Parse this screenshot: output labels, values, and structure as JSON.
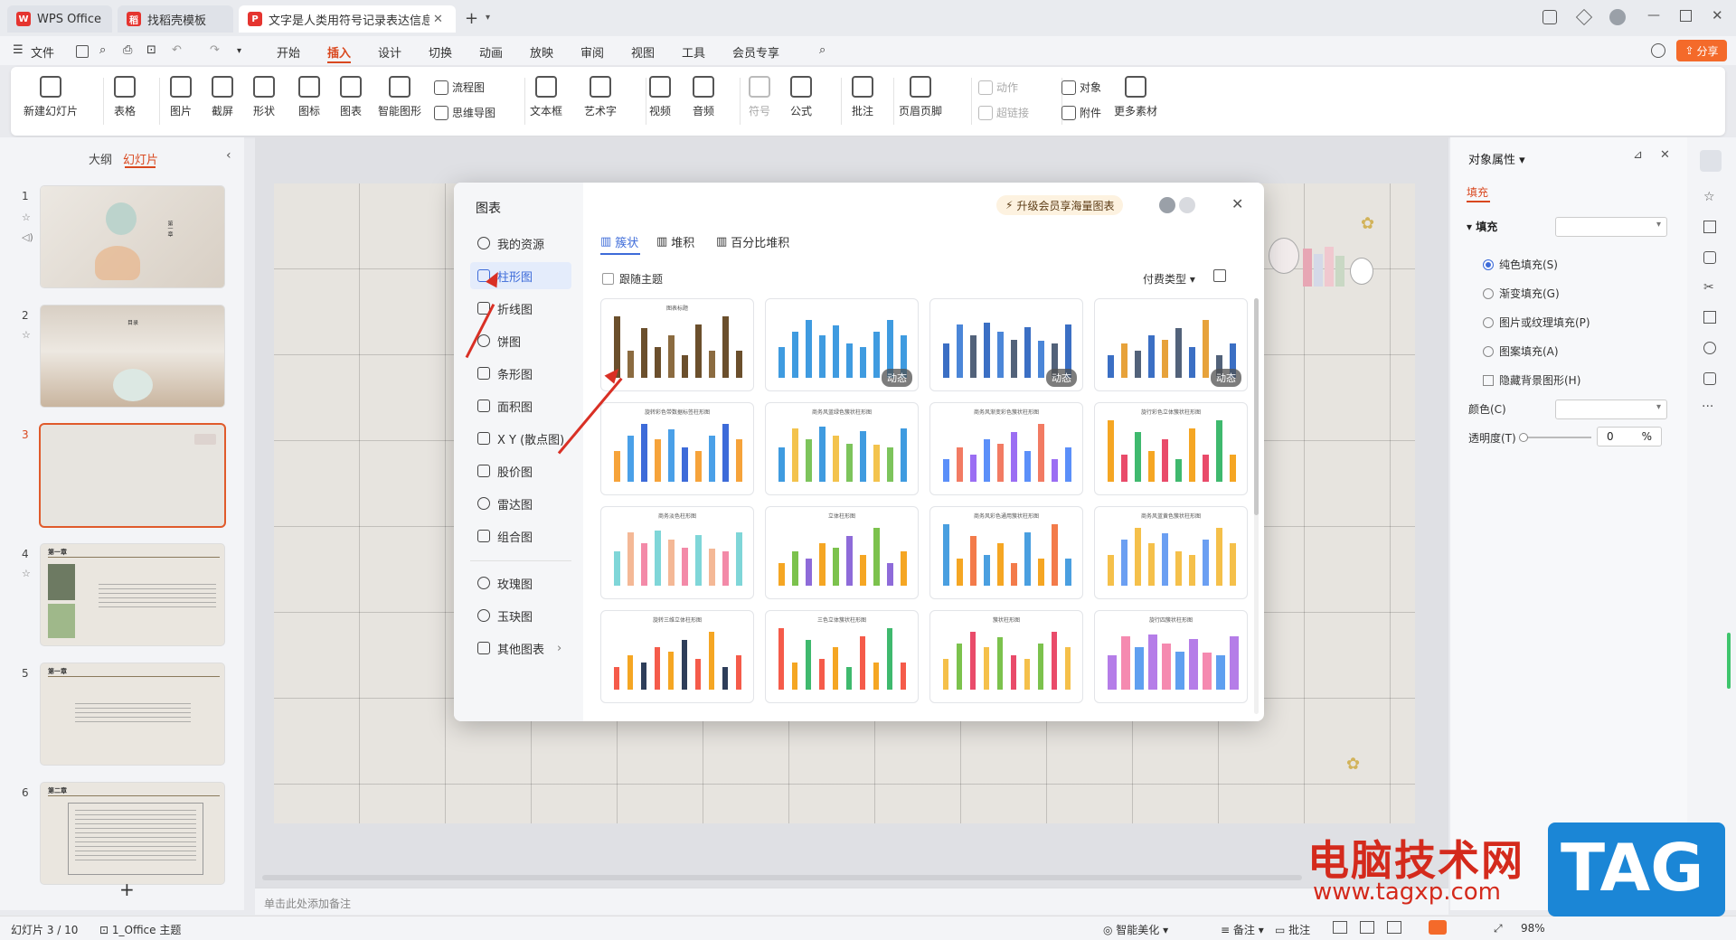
{
  "tabs": [
    {
      "label": "WPS Office"
    },
    {
      "label": "找稻壳模板"
    },
    {
      "label": "文字是人类用符号记录表达信息以"
    }
  ],
  "menu": [
    "文件",
    "开始",
    "插入",
    "设计",
    "切换",
    "动画",
    "放映",
    "审阅",
    "视图",
    "工具",
    "会员专享"
  ],
  "share_label": "分享",
  "ribbon": {
    "big": [
      "新建幻灯片",
      "表格",
      "图片",
      "截屏",
      "形状",
      "图标",
      "图表",
      "智能图形",
      "文本框",
      "艺术字",
      "视频",
      "音频",
      "符号",
      "公式",
      "批注",
      "页眉页脚",
      "更多素材"
    ],
    "small": [
      "流程图",
      "思维导图",
      "动作",
      "超链接",
      "对象",
      "附件"
    ]
  },
  "left_tabs": {
    "outline": "大纲",
    "slides": "幻灯片"
  },
  "slide_numbers": [
    "1",
    "2",
    "3",
    "4",
    "5",
    "6"
  ],
  "thumb_text": {
    "s1": "第一章",
    "s2": "目录",
    "s4": "第一章",
    "s5": "第一章",
    "s6": "第二章"
  },
  "add_slide": "+",
  "dialog": {
    "title": "图表",
    "side_items": [
      "我的资源",
      "柱形图",
      "折线图",
      "饼图",
      "条形图",
      "面积图",
      "X Y (散点图)",
      "股价图",
      "雷达图",
      "组合图",
      "玫瑰图",
      "玉玦图",
      "其他图表"
    ],
    "upgrade": "升级会员享海量图表",
    "subtabs": [
      "簇状",
      "堆积",
      "百分比堆积"
    ],
    "follow_theme": "跟随主题",
    "pay_type": "付费类型",
    "dynamic_badge": "动态",
    "card_titles": [
      "图表标题",
      "",
      "",
      "",
      "旋转彩色带数据标签柱形图",
      "商务风蓝绿色簇状柱形图",
      "商务风渐变彩色簇状柱形图",
      "旋行彩色立体簇状柱形图",
      "商务淡色柱形图",
      "立体柱形图",
      "商务风彩色通用簇状柱形图",
      "商务风蓝黄色簇状柱形图",
      "旋转三维立体柱形图",
      "三色立体簇状柱形图",
      "簇状柱形图",
      "旋行四簇状柱形图"
    ]
  },
  "notes_placeholder": "单击此处添加备注",
  "right_panel": {
    "title": "对象属性",
    "tab_fill": "填充",
    "section_fill": "填充",
    "options": [
      "纯色填充(S)",
      "渐变填充(G)",
      "图片或纹理填充(P)",
      "图案填充(A)"
    ],
    "hide_bg": "隐藏背景图形(H)",
    "color_label": "颜色(C)",
    "transparency_label": "透明度(T)",
    "transparency_value": "0",
    "percent": "%"
  },
  "status": {
    "slide_info": "幻灯片 3 / 10",
    "theme": "1_Office 主题",
    "beautify": "智能美化",
    "notes": "备注",
    "comment": "批注",
    "zoom": "98%"
  },
  "watermark": {
    "text": "电脑技术网",
    "url": "www.tagxp.com",
    "logo": "TAG"
  },
  "colors": {
    "accent": "#3d6bd9",
    "brand_red": "#d93025",
    "wps_red": "#e5342f",
    "share_orange": "#f46a2a"
  }
}
